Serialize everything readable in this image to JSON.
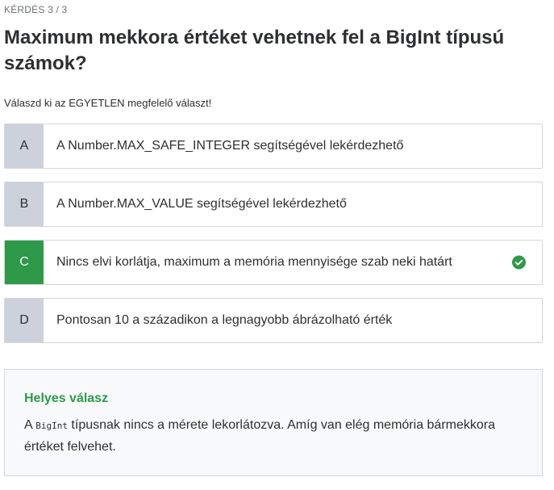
{
  "quiz": {
    "progress": "KÉRDÉS 3 / 3",
    "question": "Maximum mekkora értéket vehetnek fel a BigInt típusú számok?",
    "instruction": "Válaszd ki az EGYETLEN megfelelő választ!",
    "options": [
      {
        "letter": "A",
        "text": "A Number.MAX_SAFE_INTEGER segítségével lekérdezhető",
        "correct": false
      },
      {
        "letter": "B",
        "text": "A Number.MAX_VALUE segítségével lekérdezhető",
        "correct": false
      },
      {
        "letter": "C",
        "text": "Nincs elvi korlátja, maximum a memória mennyisége szab neki határt",
        "correct": true,
        "status_icon": "check-circle-icon"
      },
      {
        "letter": "D",
        "text": "Pontosan 10 a századikon a legnagyobb ábrázolható érték",
        "correct": false
      }
    ]
  },
  "explanation": {
    "title": "Helyes válasz",
    "body_prefix": "A ",
    "body_code": "BigInt",
    "body_suffix": " típusnak nincs a mérete lekorlátozva. Amíg van elég memória bármekkora értéket felvehet."
  },
  "colors": {
    "correct": "#2e9949",
    "letter_bg": "#cdd1db",
    "border": "#d1d7dc",
    "explain_bg": "#f7f9fa",
    "text": "#2d2f31"
  }
}
